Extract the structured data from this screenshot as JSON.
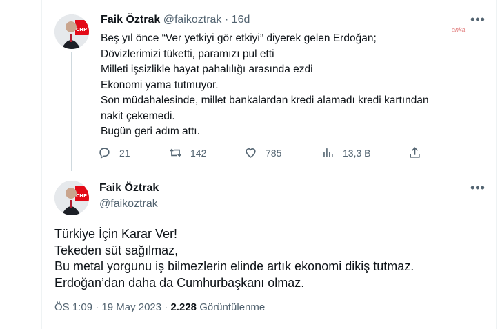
{
  "tweet1": {
    "author_name": "Faik Öztrak",
    "handle": "@faikoztrak",
    "age": "16d",
    "lines": [
      "Beş yıl önce “Ver yetkiyi gör etkiyi” diyerek gelen Erdoğan;",
      "Dövizlerimizi tüketti, paramızı pul etti",
      "Milleti işsizlikle hayat pahalılığı arasında ezdi",
      "Ekonomi yama tutmuyor.",
      "Son müdahalesinde, millet bankalardan kredi alamadı kredi kartından",
      "nakit çekemedi.",
      "Bugün geri adım attı."
    ],
    "replies": "21",
    "retweets": "142",
    "likes": "785",
    "views": "13,3 B",
    "watermark": "anka"
  },
  "tweet2": {
    "author_name": "Faik Öztrak",
    "handle": "@faikoztrak",
    "lines": [
      "Türkiye İçin Karar Ver!",
      "Tekeden süt sağılmaz,",
      "Bu metal yorgunu iş bilmezlerin elinde artık ekonomi dikiş tutmaz.",
      "Erdoğan’dan daha da Cumhurbaşkanı olmaz."
    ],
    "time": "ÖS 1:09",
    "date": "19 May 2023",
    "view_count": "2.228",
    "view_label": "Görüntülenme"
  },
  "icons": [
    "reply-icon",
    "retweet-icon",
    "like-icon",
    "views-icon",
    "share-icon",
    "more-icon"
  ],
  "colors": {
    "text": "#0f1419",
    "muted": "#536471",
    "border": "#eff3f4",
    "party_red": "#e30a17"
  }
}
